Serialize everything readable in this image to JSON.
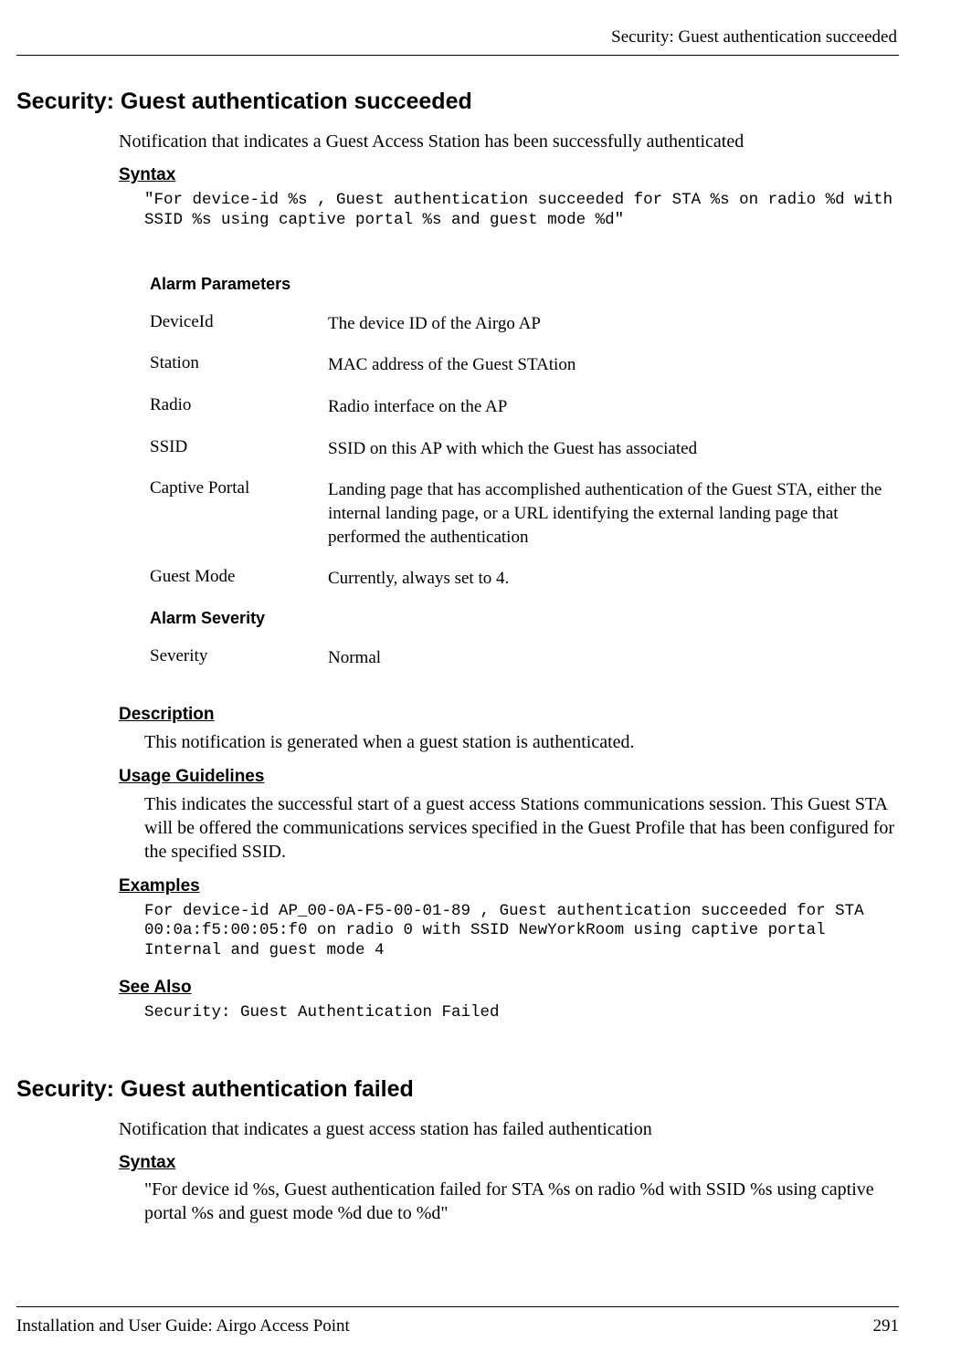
{
  "header": {
    "right_text": "Security: Guest authentication succeeded"
  },
  "section1": {
    "title": "Security: Guest authentication succeeded",
    "intro": "Notification that indicates a Guest Access Station has been successfully authenticated",
    "syntax_heading": "Syntax",
    "syntax_text": "\"For device-id %s , Guest authentication succeeded for STA %s on radio %d with SSID %s using captive portal %s and guest mode %d\"",
    "alarm_params_heading": "Alarm Parameters",
    "params": [
      {
        "name": " DeviceId",
        "desc": "The device ID of the Airgo AP"
      },
      {
        "name": " Station",
        "desc": "MAC address of the Guest STAtion"
      },
      {
        "name": "Radio",
        "desc": "Radio interface on the AP"
      },
      {
        "name": "SSID",
        "desc": " SSID on this AP with which the Guest has associated"
      },
      {
        "name": "Captive Portal",
        "desc": "Landing page that has accomplished authentication of the Guest STA, either the internal landing page, or a URL identifying the external landing page that performed the authentication"
      },
      {
        "name": "Guest Mode",
        "desc": "Currently, always set to 4."
      }
    ],
    "alarm_severity_heading": "Alarm Severity",
    "severity": {
      "name": "Severity",
      "desc": "Normal"
    },
    "description_heading": "Description",
    "description_text": "This notification is generated when a guest station is authenticated.",
    "usage_heading": "Usage Guidelines",
    "usage_text": "This indicates the successful start of a guest access Stations communications session.  This Guest STA will be offered the communications services specified in the Guest Profile that has been configured for the specified SSID.",
    "examples_heading": "Examples",
    "examples_text": "For device-id AP_00-0A-F5-00-01-89 , Guest authentication succeeded for STA 00:0a:f5:00:05:f0 on radio 0 with SSID NewYorkRoom using captive portal Internal and guest mode 4",
    "seealso_heading": "See Also",
    "seealso_text": "Security: Guest Authentication Failed"
  },
  "section2": {
    "title": "Security: Guest authentication failed",
    "intro": "Notification that indicates a guest access station has failed authentication",
    "syntax_heading": "Syntax",
    "syntax_text": "\"For device id %s,  Guest authentication failed for STA %s on radio %d with SSID %s using captive portal %s and guest mode %d due to %d\""
  },
  "footer": {
    "left": "Installation and User Guide: Airgo Access Point",
    "right": "291"
  }
}
